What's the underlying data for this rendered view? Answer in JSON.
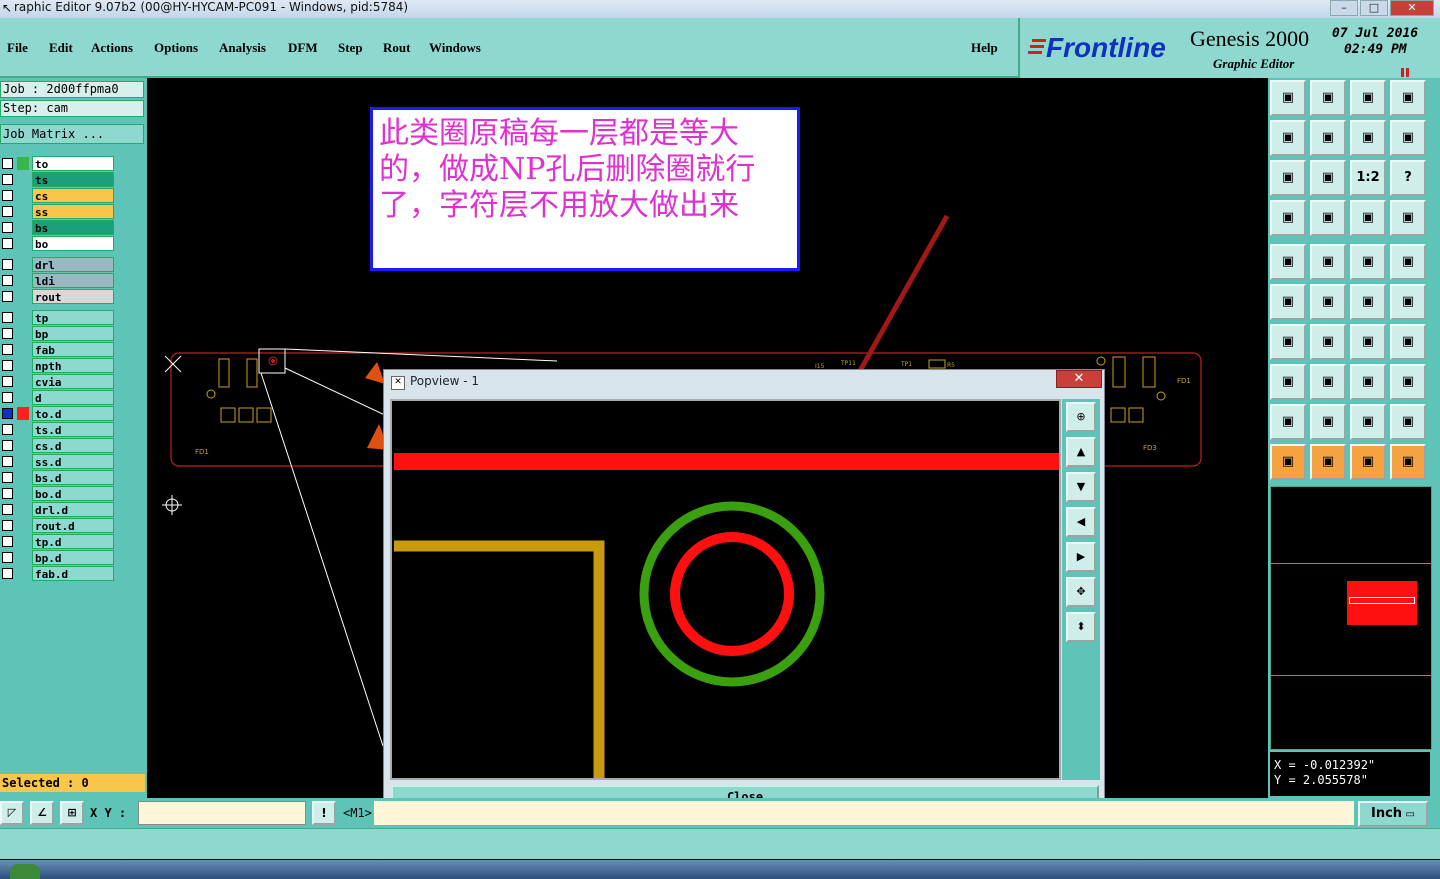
{
  "window": {
    "title": "raphic Editor 9.07b2 (00@HY-HYCAM-PC091 - Windows, pid:5784)"
  },
  "menu": [
    "File",
    "Edit",
    "Actions",
    "Options",
    "Analysis",
    "DFM",
    "Step",
    "Rout",
    "Windows"
  ],
  "help_label": "Help",
  "brand": {
    "logo": "Frontline",
    "product": "Genesis 2000",
    "subtitle": "Graphic Editor",
    "date": "07 Jul 2016",
    "time": "02:49 PM"
  },
  "job": {
    "job_line": "Job : 2d00ffpma0",
    "step_line": "Step: cam",
    "matrix_label": "Job Matrix ..."
  },
  "layers": [
    {
      "name": "to",
      "bg": "#ffffff",
      "swatch": "#39b54a",
      "group": 1
    },
    {
      "name": "ts",
      "bg": "#1aa07a",
      "swatch": "",
      "group": 1
    },
    {
      "name": "cs",
      "bg": "#f7c64a",
      "swatch": "",
      "group": 1
    },
    {
      "name": "ss",
      "bg": "#f7c64a",
      "swatch": "",
      "group": 1
    },
    {
      "name": "bs",
      "bg": "#1aa07a",
      "swatch": "",
      "group": 1
    },
    {
      "name": "bo",
      "bg": "#ffffff",
      "swatch": "",
      "group": 1
    },
    {
      "name": "drl",
      "bg": "#9ab8c0",
      "swatch": "",
      "group": 2
    },
    {
      "name": "ldi",
      "bg": "#9ab8c0",
      "swatch": "",
      "group": 2
    },
    {
      "name": "rout",
      "bg": "#d8d8d8",
      "swatch": "",
      "group": 2
    },
    {
      "name": "tp",
      "bg": "#8ed8d0",
      "swatch": "",
      "group": 3
    },
    {
      "name": "bp",
      "bg": "#8ed8d0",
      "swatch": "",
      "group": 3
    },
    {
      "name": "fab",
      "bg": "#8ed8d0",
      "swatch": "",
      "group": 3
    },
    {
      "name": "npth",
      "bg": "#8ed8d0",
      "swatch": "",
      "group": 3
    },
    {
      "name": "cvia",
      "bg": "#8ed8d0",
      "swatch": "",
      "group": 3
    },
    {
      "name": "d",
      "bg": "#8ed8d0",
      "swatch": "",
      "group": 3
    },
    {
      "name": "to.d",
      "bg": "#8ed8d0",
      "swatch": "#ff2020",
      "group": 3,
      "checked": true
    },
    {
      "name": "ts.d",
      "bg": "#8ed8d0",
      "swatch": "",
      "group": 3
    },
    {
      "name": "cs.d",
      "bg": "#8ed8d0",
      "swatch": "",
      "group": 3
    },
    {
      "name": "ss.d",
      "bg": "#8ed8d0",
      "swatch": "",
      "group": 3
    },
    {
      "name": "bs.d",
      "bg": "#8ed8d0",
      "swatch": "",
      "group": 3
    },
    {
      "name": "bo.d",
      "bg": "#8ed8d0",
      "swatch": "",
      "group": 3
    },
    {
      "name": "drl.d",
      "bg": "#8ed8d0",
      "swatch": "",
      "group": 3
    },
    {
      "name": "rout.d",
      "bg": "#8ed8d0",
      "swatch": "",
      "group": 3
    },
    {
      "name": "tp.d",
      "bg": "#8ed8d0",
      "swatch": "",
      "group": 3
    },
    {
      "name": "bp.d",
      "bg": "#8ed8d0",
      "swatch": "",
      "group": 3
    },
    {
      "name": "fab.d",
      "bg": "#8ed8d0",
      "swatch": "",
      "group": 3
    }
  ],
  "selected_label": "Selected : 0",
  "note_text": "此类圈原稿每一层都是等大的，做成NP孔后删除圈就行了，字符层不用放大做出来",
  "popup": {
    "title": "Popview - 1",
    "close_label": "Close",
    "close_x": "✕"
  },
  "coords": {
    "x_line": "X = -0.012392\"",
    "y_line": "Y = 2.055578\""
  },
  "bottom": {
    "xy_label": "X Y :",
    "mode_label": "<M1>",
    "excl": "!",
    "unit_label": "Inch"
  },
  "toolbar_icons": [
    "zoom-home",
    "zoom-in",
    "zoom-home-alt",
    "zoom-window",
    "pan-left",
    "pan-right",
    "snap",
    "s-curve",
    "fit",
    "center",
    "1:2",
    "help",
    "display-ctrl",
    "pad",
    "net-a",
    "net-b",
    "select-pad",
    "zone",
    "ruler",
    "circle",
    "connect",
    "cross",
    "move-red",
    "move-blue",
    "line",
    "line-blue",
    "undo",
    "ff",
    "sel-a",
    "sel-b",
    "sel-c",
    "sel-d",
    "tri-a",
    "tri-b",
    "tri-c",
    "tri-d",
    "arrow",
    "arrow-box",
    "arrow-box2",
    "wave"
  ],
  "toolbar_labels": {
    "1:2": "1:2",
    "help": "?"
  }
}
